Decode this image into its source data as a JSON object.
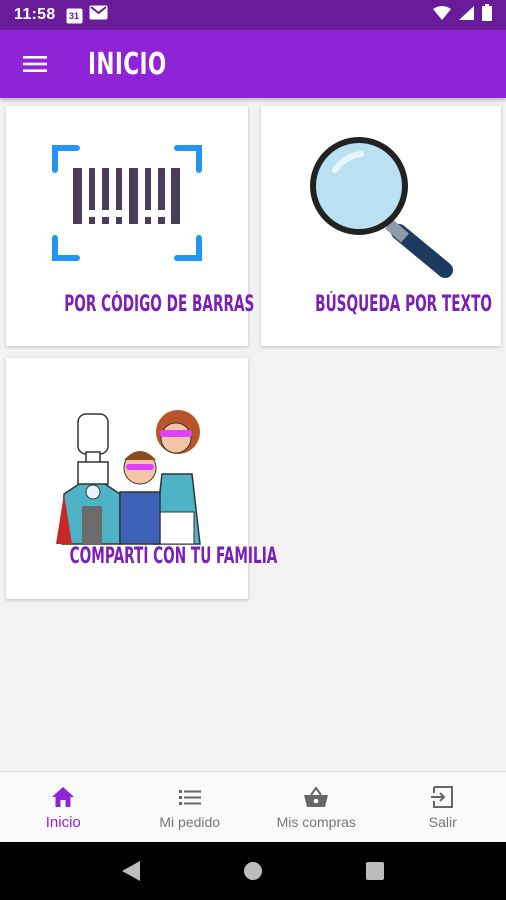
{
  "status_bar": {
    "time": "11:58",
    "calendar_day": "31"
  },
  "app_bar": {
    "title": "INICIO"
  },
  "cards": [
    {
      "label": "POR CÓDIGO DE BARRAS"
    },
    {
      "label": "BÚSQUEDA POR TEXTO"
    },
    {
      "label": "COMPARTÍ CON TU FAMILIA"
    }
  ],
  "bottom_nav": {
    "items": [
      {
        "label": "Inicio",
        "icon": "home-icon",
        "active": true
      },
      {
        "label": "Mi pedido",
        "icon": "list-icon"
      },
      {
        "label": "Mis compras",
        "icon": "basket-icon"
      },
      {
        "label": "Salir",
        "icon": "exit-icon"
      }
    ]
  },
  "colors": {
    "status_bar": "#6a1b9a",
    "app_bar": "#8e24d6",
    "accent": "#7b1fb8"
  }
}
